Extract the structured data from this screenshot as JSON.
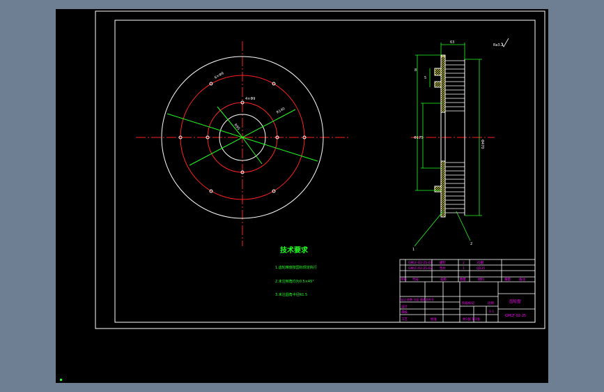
{
  "tech": {
    "title": "技术要求",
    "notes": [
      "1.齿轮精度按国标规定执行",
      "2.未注倒角均为0.5×45°",
      "3.未注圆角半径R1.5"
    ]
  },
  "title_block": {
    "rows": [
      [
        "GMLF-02-25-01",
        "螺钉",
        "2",
        "35钢"
      ],
      [
        "GMLF-02-25-02",
        "垫片",
        "1",
        "Q235"
      ]
    ],
    "header": [
      "序号",
      "代号",
      "名称",
      "数量",
      "材料",
      "重量",
      "备注"
    ],
    "part_name": "齿轮盘",
    "drawing_no": "GMLF-02-25",
    "scale_label": "比例",
    "scale": "1:1",
    "sheet": "共1张  第1张",
    "designer": "设计",
    "checker": "审核",
    "process": "工艺",
    "approve": "批准",
    "mark_label": "标记 处数 分区 更改文件号",
    "stage_label": "阶段标记"
  },
  "roughness": "Ra3.2",
  "dims": {
    "top": "63",
    "right": "Φ470",
    "left_inner": "Φ175",
    "left_small1": "8",
    "left_small2": "5",
    "leader_a": "1",
    "leader_b": "2",
    "holes_outer": "6×Φ9",
    "holes_inner": "4×Φ9",
    "radius_a": "R140",
    "radius_b": "R95"
  },
  "colors": {
    "background": "#000000",
    "frame": "#ffffff",
    "center_line": "#ff2020",
    "dimension": "#20ff20",
    "text_block": "#ff00ff",
    "hatch": "#ffff00"
  }
}
